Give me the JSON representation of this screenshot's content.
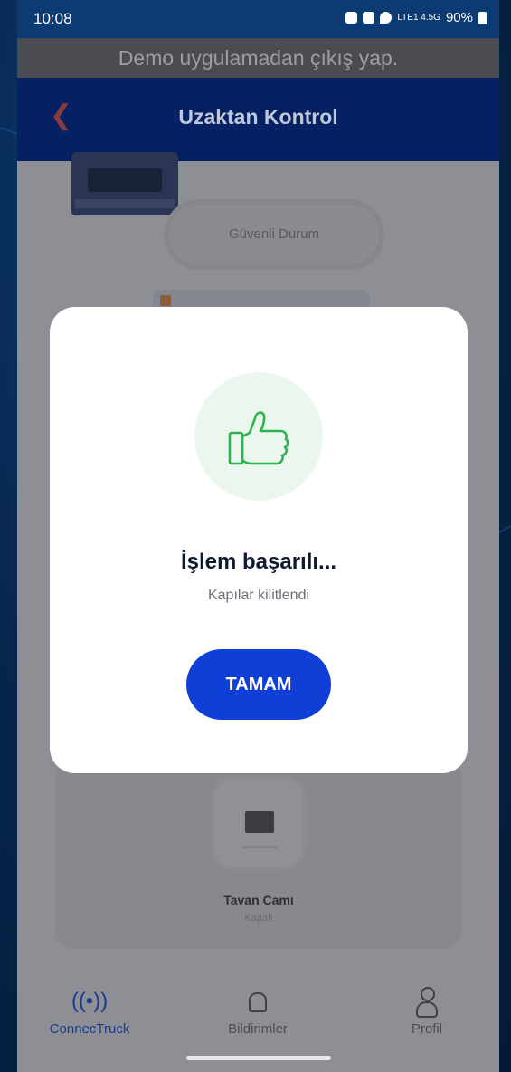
{
  "status_bar": {
    "time": "10:08",
    "battery": "90%",
    "network": "LTE1 4.5G"
  },
  "demo_banner": "Demo uygulamadan çıkış yap.",
  "header": {
    "title": "Uzaktan Kontrol",
    "back_icon": "chevron-left-icon"
  },
  "background_content": {
    "status_pill": "Güvenli Durum",
    "card": {
      "label": "Tavan Camı",
      "status": "Kapalı"
    }
  },
  "modal": {
    "icon": "thumbs-up-icon",
    "title": "İşlem başarılı...",
    "subtitle": "Kapılar kilitlendi",
    "button_label": "TAMAM"
  },
  "bottom_nav": {
    "items": [
      {
        "label": "ConnecTruck",
        "icon": "((•))",
        "active": true
      },
      {
        "label": "Bildirimler",
        "icon": "bell-icon",
        "active": false
      },
      {
        "label": "Profil",
        "icon": "person-icon",
        "active": false
      }
    ]
  },
  "colors": {
    "primary": "#0f3fd6",
    "header_bg": "#062163",
    "success_circle": "#eaf6ee",
    "success_icon": "#2fb34f"
  }
}
